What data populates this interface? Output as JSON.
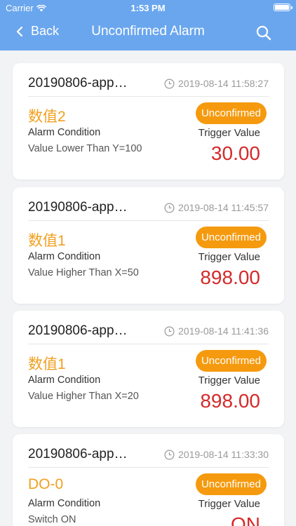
{
  "status_bar": {
    "carrier": "Carrier",
    "time": "1:53 PM"
  },
  "navbar": {
    "back_label": "Back",
    "title": "Unconfirmed Alarm"
  },
  "labels": {
    "alarm_condition": "Alarm Condition",
    "trigger_value": "Trigger Value"
  },
  "alarms": [
    {
      "id": "20190806-app…",
      "timestamp": "2019-08-14 11:58:27",
      "metric": "数值2",
      "status": "Unconfirmed",
      "condition": "Value Lower Than Y=100",
      "trigger_value": "30.00"
    },
    {
      "id": "20190806-app…",
      "timestamp": "2019-08-14 11:45:57",
      "metric": "数值1",
      "status": "Unconfirmed",
      "condition": "Value Higher Than X=50",
      "trigger_value": "898.00"
    },
    {
      "id": "20190806-app…",
      "timestamp": "2019-08-14 11:41:36",
      "metric": "数值1",
      "status": "Unconfirmed",
      "condition": "Value Higher Than X=20",
      "trigger_value": "898.00"
    },
    {
      "id": "20190806-app…",
      "timestamp": "2019-08-14 11:33:30",
      "metric": "DO-0",
      "status": "Unconfirmed",
      "condition": "Switch ON",
      "trigger_value": "ON"
    }
  ],
  "colors": {
    "header": "#6aa6ee",
    "metric": "#f0a020",
    "badge": "#f59a0e",
    "trigger_value": "#d42a2a",
    "background": "#f2f3f5"
  }
}
